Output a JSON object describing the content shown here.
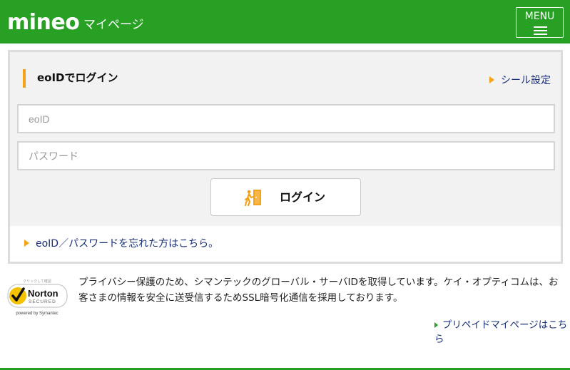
{
  "header": {
    "logo": "mineo",
    "subtitle": "マイページ",
    "menu_label": "MENU",
    "bg_color": "#27a023"
  },
  "login_panel": {
    "title": "eoIDでログイン",
    "seal_link": "シール設定",
    "id_placeholder": "eoID",
    "password_placeholder": "パスワード",
    "login_button": "ログイン",
    "login_icon": "door-exit-icon",
    "forgot_link": "eoID／パスワードを忘れた方はこちら。",
    "accent_color": "#f5a21b"
  },
  "security": {
    "badge_top": "クリックして確認",
    "badge_name": "Norton",
    "badge_secured": "SECURED",
    "badge_powered": "powered by Symantec",
    "notice": "プライバシー保護のため、シマンテックのグローバル・サーバIDを取得しています。ケイ・オプティコムは、お客さまの情報を安全に送受信するためSSL暗号化通信を採用しております。"
  },
  "footer": {
    "prepaid_link": "プリペイドマイページはこちら"
  }
}
